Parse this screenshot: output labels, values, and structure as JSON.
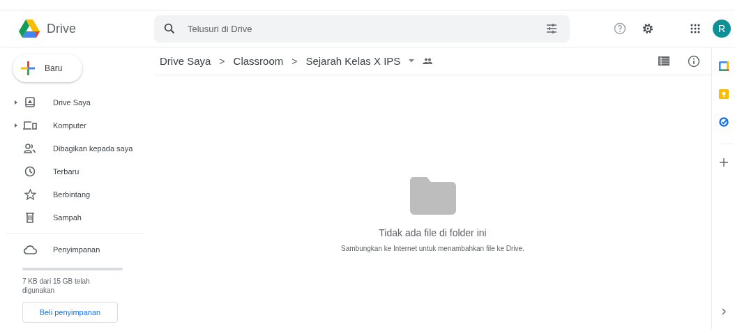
{
  "app": {
    "name": "Drive"
  },
  "search": {
    "placeholder": "Telusuri di Drive"
  },
  "account": {
    "initial": "R"
  },
  "new_button": {
    "label": "Baru"
  },
  "nav": [
    {
      "label": "Drive Saya",
      "expandable": true
    },
    {
      "label": "Komputer",
      "expandable": true
    },
    {
      "label": "Dibagikan kepada saya",
      "expandable": false
    },
    {
      "label": "Terbaru",
      "expandable": false
    },
    {
      "label": "Berbintang",
      "expandable": false
    },
    {
      "label": "Sampah",
      "expandable": false
    }
  ],
  "storage": {
    "label": "Penyimpanan",
    "level": 0.0,
    "usage": "7 KB dari 15 GB telah digunakan",
    "buy": "Beli penyimpanan"
  },
  "breadcrumb": [
    "Drive Saya",
    "Classroom",
    "Sejarah Kelas X IPS"
  ],
  "separator": ">",
  "empty": {
    "title": "Tidak ada file di folder ini",
    "subtitle": "Sambungkan ke Internet untuk menambahkan file ke Drive."
  }
}
